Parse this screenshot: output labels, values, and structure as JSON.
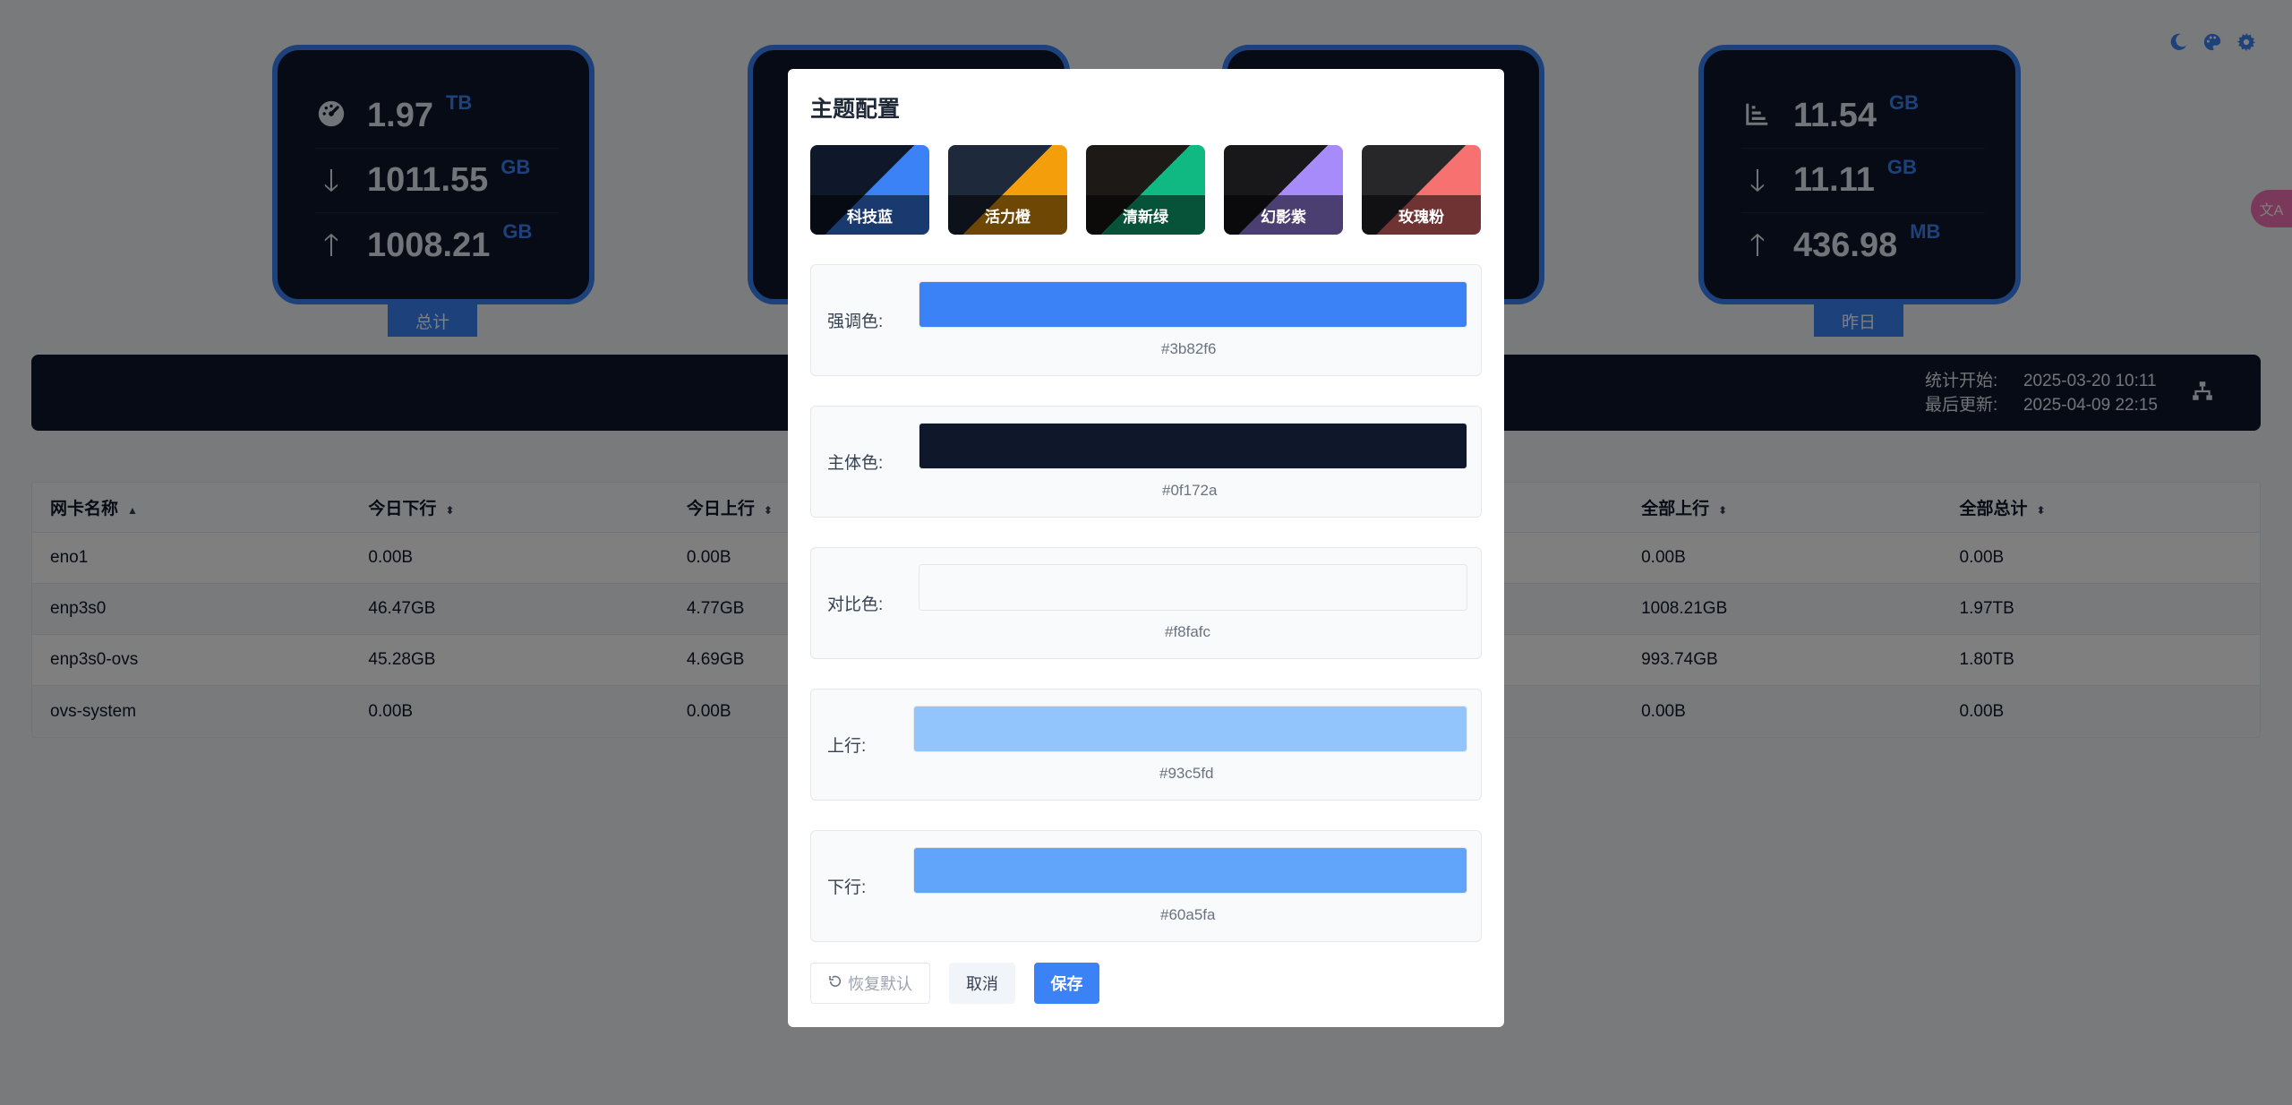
{
  "cards": [
    {
      "label": "总计",
      "rows": [
        {
          "icon": "speedometer-icon",
          "value": "1.97",
          "unit": "TB"
        },
        {
          "icon": "arrow-down-icon",
          "value": "1011.55",
          "unit": "GB"
        },
        {
          "icon": "arrow-up-icon",
          "value": "1008.21",
          "unit": "GB"
        }
      ]
    },
    {
      "label": "昨日",
      "rows": [
        {
          "icon": "bar-chart-icon",
          "value": "11.54",
          "unit": "GB"
        },
        {
          "icon": "arrow-down-icon",
          "value": "11.11",
          "unit": "GB"
        },
        {
          "icon": "arrow-up-icon",
          "value": "436.98",
          "unit": "MB"
        }
      ]
    }
  ],
  "info": {
    "start_label": "统计开始:",
    "start_value": "2025-03-20 10:11",
    "update_label": "最后更新:",
    "update_value": "2025-04-09 22:15",
    "icon": "network-icon"
  },
  "table": {
    "columns": [
      "网卡名称",
      "今日下行",
      "今日上行",
      "",
      "",
      "全部上行",
      "全部总计"
    ],
    "rows": [
      [
        "eno1",
        "0.00B",
        "0.00B",
        "",
        "",
        "0.00B",
        "0.00B"
      ],
      [
        "enp3s0",
        "46.47GB",
        "4.77GB",
        "",
        "",
        "1008.21GB",
        "1.97TB"
      ],
      [
        "enp3s0-ovs",
        "45.28GB",
        "4.69GB",
        "",
        "",
        "993.74GB",
        "1.80TB"
      ],
      [
        "ovs-system",
        "0.00B",
        "0.00B",
        "",
        "",
        "0.00B",
        "0.00B"
      ]
    ]
  },
  "top_icons": [
    "moon-icon",
    "palette-icon",
    "gear-icon"
  ],
  "dialog": {
    "title": "主题配置",
    "presets": [
      {
        "name": "科技蓝",
        "base": "#0f172a",
        "accent": "#3b82f6"
      },
      {
        "name": "活力橙",
        "base": "#1e293b",
        "accent": "#f59e0b"
      },
      {
        "name": "清新绿",
        "base": "#1c1917",
        "accent": "#10b981"
      },
      {
        "name": "幻影紫",
        "base": "#18181b",
        "accent": "#a78bfa"
      },
      {
        "name": "玫瑰粉",
        "base": "#27272a",
        "accent": "#f87171"
      }
    ],
    "colors": [
      {
        "label": "强调色:",
        "hex": "#3b82f6",
        "color": "#3b82f6"
      },
      {
        "label": "主体色:",
        "hex": "#0f172a",
        "color": "#0f172a"
      },
      {
        "label": "对比色:",
        "hex": "#f8fafc",
        "color": "#f8fafc"
      },
      {
        "label": "上行:",
        "hex": "#93c5fd",
        "color": "#93c5fd"
      },
      {
        "label": "下行:",
        "hex": "#60a5fa",
        "color": "#60a5fa"
      }
    ],
    "buttons": {
      "reset": "恢复默认",
      "cancel": "取消",
      "save": "保存"
    }
  }
}
